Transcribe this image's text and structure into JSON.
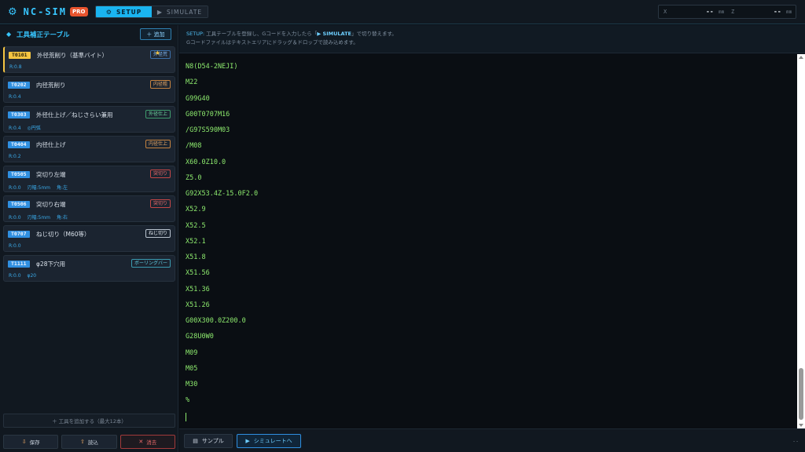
{
  "header": {
    "brand_title": "NC-SIM",
    "brand_badge": "PRO",
    "tabs": [
      {
        "label": "SETUP",
        "icon": "gear-icon",
        "glyph": "⚙"
      },
      {
        "label": "SIMULATE",
        "icon": "play-icon",
        "glyph": "▶"
      }
    ],
    "coords": {
      "x_label": "X",
      "x_value": "--",
      "x_unit": "mm",
      "z_label": "Z",
      "z_value": "--",
      "z_unit": "mm"
    }
  },
  "sidebar": {
    "title": "工具補正テーブル",
    "add_label": "＋ 追加",
    "tools": [
      {
        "code": "T0101",
        "name": "外径荒削り（基準バイト）",
        "tag": "外径荒",
        "specs": [
          "R:0.8"
        ]
      },
      {
        "code": "T0202",
        "name": "内径荒削り",
        "tag": "内径粗",
        "specs": [
          "R:0.4"
        ]
      },
      {
        "code": "T0303",
        "name": "外径仕上げ／ねじさらい兼用",
        "tag": "外径仕上",
        "specs": [
          "R:0.4",
          "◎円弧"
        ]
      },
      {
        "code": "T0404",
        "name": "内径仕上げ",
        "tag": "内径仕上",
        "specs": [
          "R:0.2"
        ]
      },
      {
        "code": "T0505",
        "name": "突切り左端",
        "tag": "突切り",
        "specs": [
          "R:0.0",
          "刃幅:5mm",
          "角:左"
        ]
      },
      {
        "code": "T0506",
        "name": "突切り右端",
        "tag": "突切り",
        "specs": [
          "R:0.0",
          "刃幅:5mm",
          "角:右"
        ]
      },
      {
        "code": "T0707",
        "name": "ねじ切り（M60等）",
        "tag": "ねじ切り",
        "specs": [
          "R:0.0"
        ]
      },
      {
        "code": "T1111",
        "name": "φ28下穴用",
        "tag": "ボーリングバー",
        "specs": [
          "R:0.0",
          "φ20"
        ]
      }
    ],
    "add_tool_label": "＋ 工具を追加する（最大12本）",
    "footer": {
      "save_label": "保存",
      "load_label": "読込",
      "clear_label": "消去"
    }
  },
  "main": {
    "info_line1_prefix": "SETUP:",
    "info_line1_mid": " 工具テーブルを登録し、Gコードを入力したら「",
    "info_line1_link": "▶ SIMULATE",
    "info_line1_suffix": "」で切り替えます。",
    "info_line2": "Gコードファイルはテキストエリアにドラッグ＆ドロップで読み込めます。",
    "code_lines": [
      "N8(D54-2NEJI)",
      "M22",
      "G99G40",
      "G00T0707M16",
      "/G97S590M03",
      "/M08",
      "X60.0Z10.0",
      "Z5.0",
      "G92X53.4Z-15.0F2.0",
      "X52.9",
      "X52.5",
      "X52.1",
      "X51.8",
      "X51.56",
      "X51.36",
      "X51.26",
      "G00X300.0Z200.0",
      "G28U0W0",
      "M09",
      "M05",
      "M30",
      "%"
    ],
    "sample_label": "サンプル",
    "simulate_label": "シミュレートへ",
    "status_right": "--"
  }
}
